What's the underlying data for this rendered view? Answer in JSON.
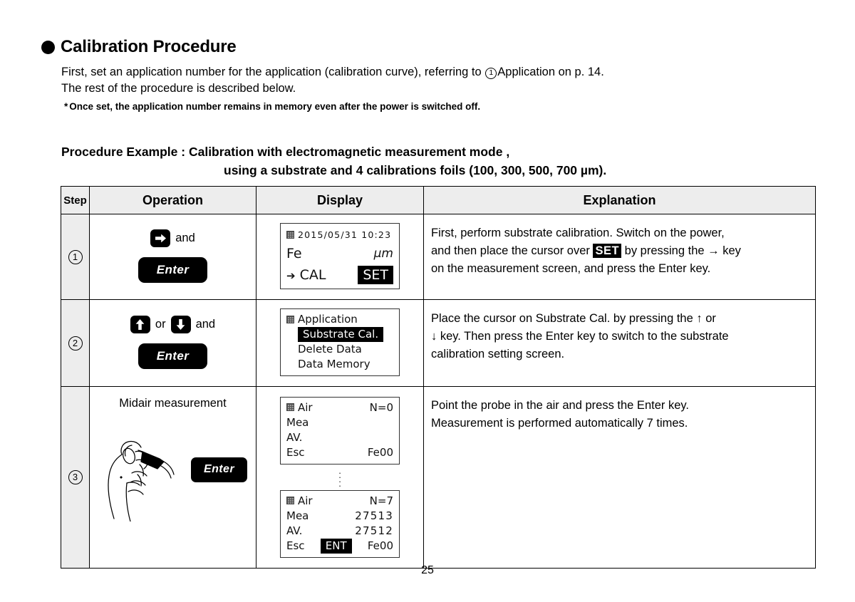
{
  "heading": {
    "bullet": "filled-circle",
    "title": "Calibration Procedure"
  },
  "intro": {
    "line1_before": "First, set an application number for the application (calibration curve), referring to ",
    "line1_circled": "1",
    "line1_after": "Application on p. 14.",
    "line2": "The rest of the procedure is described below.",
    "note_marker": "*",
    "note": "Once set, the application number remains in memory even after the power is switched off."
  },
  "procedure_title": {
    "line1": "Procedure Example : Calibration with electromagnetic measurement mode ,",
    "line2": "using a substrate and 4 calibrations foils (100, 300, 500, 700 µm)."
  },
  "table": {
    "headers": {
      "step": "Step",
      "operation": "Operation",
      "display": "Display",
      "explanation": "Explanation"
    },
    "rows": [
      {
        "step": "1",
        "operation": {
          "key1_icon": "arrow-right-key",
          "conj1": "and",
          "enter_label": "Enter"
        },
        "display": {
          "datetime": "2015/05/31 10:23",
          "material": "Fe",
          "unit": "µm",
          "cursor_arrow": "➔",
          "cal_label": "CAL",
          "set_label": "SET"
        },
        "explanation": {
          "l1": "First, perform substrate calibration. Switch on the power,",
          "l2_a": "and then place the cursor over ",
          "l2_hl": "SET",
          "l2_b": " by pressing the → key",
          "l3": "on the measurement screen, and press the Enter key."
        }
      },
      {
        "step": "2",
        "operation": {
          "key1_icon": "arrow-up-key",
          "conj1": "or",
          "key2_icon": "arrow-down-key",
          "conj2": "and",
          "enter_label": "Enter"
        },
        "display": {
          "menu": [
            {
              "label": "Application",
              "selected": false
            },
            {
              "label": "Substrate Cal.",
              "selected": true
            },
            {
              "label": "Delete Data",
              "selected": false
            },
            {
              "label": "Data Memory",
              "selected": false
            }
          ]
        },
        "explanation": {
          "l1": "Place the cursor on Substrate Cal. by pressing the ↑ or",
          "l2": "↓ key. Then press the Enter key to switch to the substrate",
          "l3": "calibration setting screen."
        }
      },
      {
        "step": "3",
        "operation": {
          "caption": "Midair measurement",
          "illustration": "hand-holding-probe",
          "enter_label": "Enter"
        },
        "display": {
          "screen_top": {
            "title": "Air",
            "count": "N=0",
            "mea_label": "Mea",
            "mea_value": "",
            "av_label": "AV.",
            "av_value": "",
            "esc_label": "Esc",
            "ent_label": "",
            "fe_label": "Fe00"
          },
          "separator": "vertical-ellipsis",
          "screen_bottom": {
            "title": "Air",
            "count": "N=7",
            "mea_label": "Mea",
            "mea_value": "27513",
            "av_label": "AV.",
            "av_value": "27512",
            "esc_label": "Esc",
            "ent_label": "ENT",
            "fe_label": "Fe00"
          }
        },
        "explanation": {
          "l1": "Point the probe in the air and press the Enter key.",
          "l2": "Measurement is performed automatically 7 times."
        }
      }
    ]
  },
  "footer": {
    "page_number": "25"
  },
  "colors": {
    "header_fill": "#ededed",
    "text": "#000000",
    "border": "#000000",
    "inverse_bg": "#000000",
    "inverse_fg": "#ffffff"
  }
}
